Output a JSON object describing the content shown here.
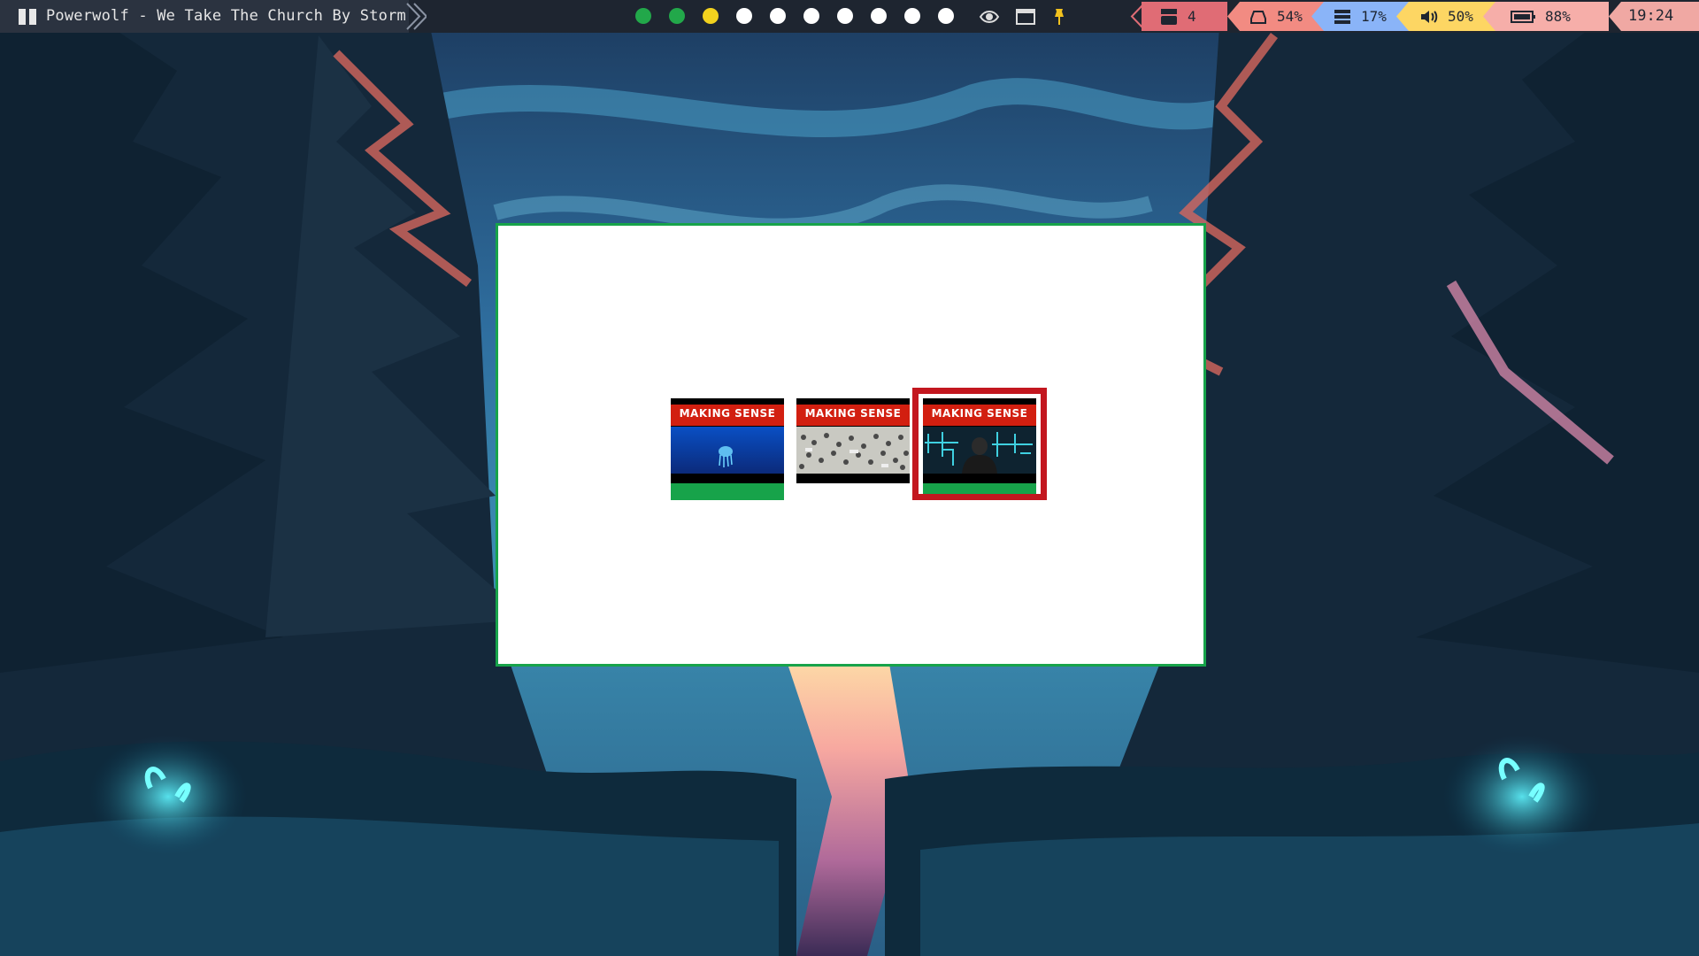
{
  "topbar": {
    "now_playing": "Powerwolf - We Take The Church By Storm",
    "workspace_colors": [
      "#22a84a",
      "#22a84a",
      "#f2d21e",
      "#ffffff",
      "#ffffff",
      "#ffffff",
      "#ffffff",
      "#ffffff",
      "#ffffff",
      "#ffffff"
    ],
    "icons": [
      "eye-icon",
      "window-icon",
      "pin-icon"
    ],
    "status": {
      "youtube": {
        "value": "4",
        "color": "#e06c75"
      },
      "disk": {
        "value": "54%",
        "color": "#f28b82"
      },
      "memory": {
        "value": "17%",
        "color": "#8ab4f8"
      },
      "volume": {
        "value": "50%",
        "color": "#fdd663"
      },
      "battery": {
        "value": "88%",
        "color": "#f6aea9"
      }
    },
    "clock": "19:24"
  },
  "switcher": {
    "border_color": "#17a34a",
    "items": [
      {
        "label": "MAKING SENSE",
        "art": "underwater-jellyfish",
        "has_indicator": true,
        "selected": false
      },
      {
        "label": "MAKING SENSE",
        "art": "crowd",
        "has_indicator": false,
        "selected": false
      },
      {
        "label": "MAKING SENSE",
        "art": "whiteboard-speaker",
        "has_indicator": true,
        "selected": true
      }
    ]
  }
}
